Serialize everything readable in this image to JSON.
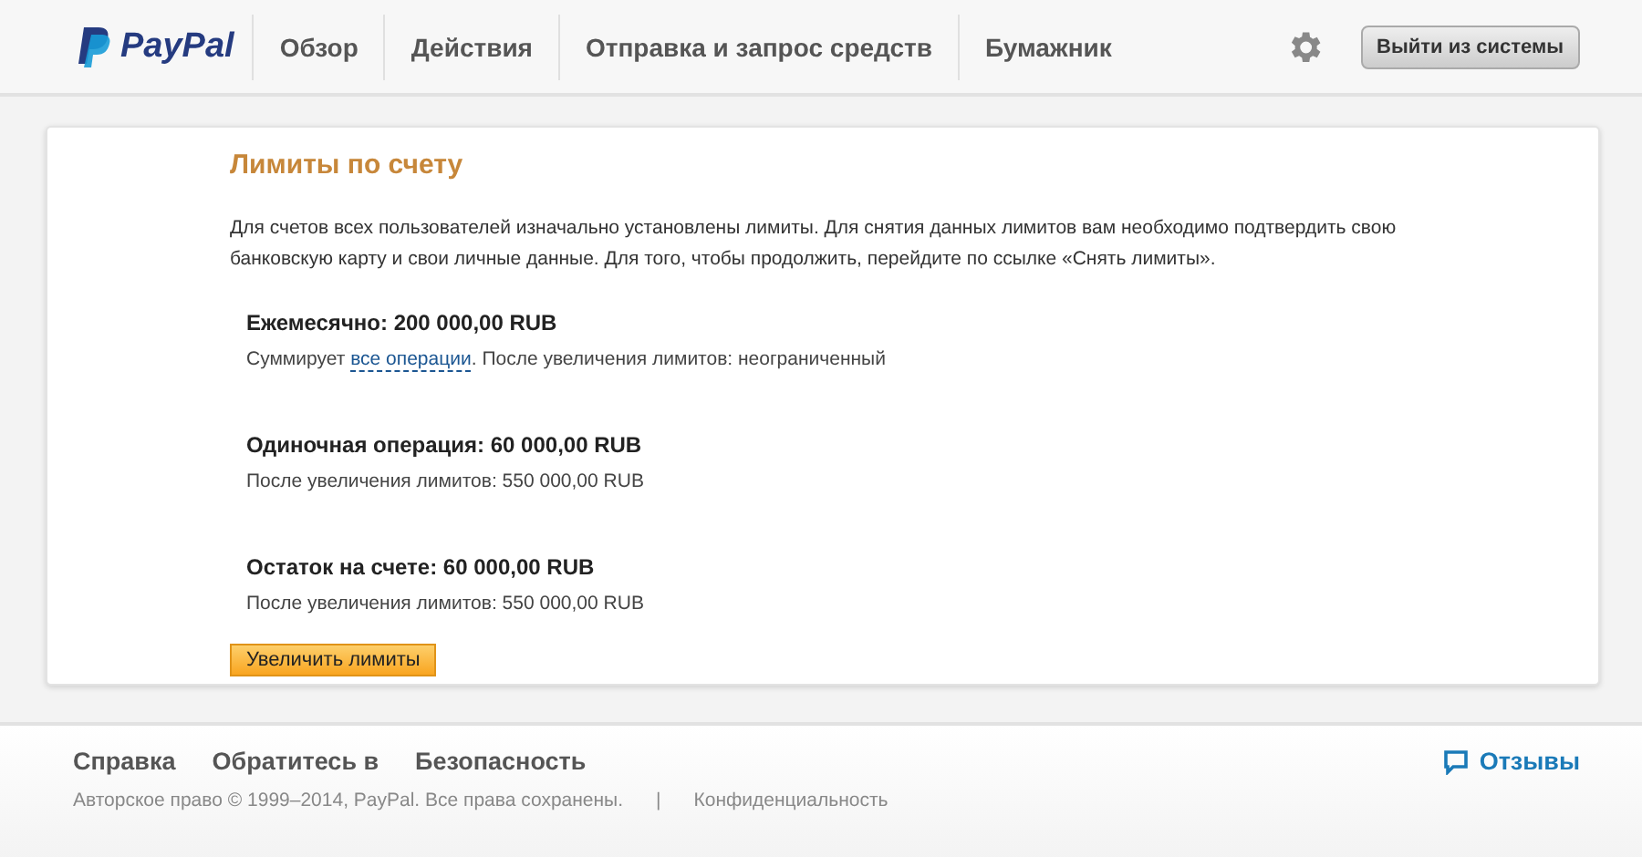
{
  "header": {
    "logo": "PayPal",
    "nav": [
      {
        "label": "Обзор"
      },
      {
        "label": "Действия"
      },
      {
        "label": "Отправка и запрос средств"
      },
      {
        "label": "Бумажник"
      }
    ],
    "logout": "Выйти из системы"
  },
  "card": {
    "title": "Лимиты по счету",
    "intro": "Для счетов всех пользователей изначально установлены лимиты. Для снятия данных лимитов вам необходимо подтвердить свою банковскую карту и свои личные данные. Для того, чтобы продолжить, перейдите по ссылке «Снять лимиты».",
    "limits": [
      {
        "heading": "Ежемесячно: 200 000,00 RUB",
        "note_before": "Суммирует ",
        "note_link": "все операции",
        "note_after": ". После увеличения лимитов: неограниченный"
      },
      {
        "heading": "Одиночная операция: 60 000,00 RUB",
        "note_before": "После увеличения лимитов: 550 000,00 RUB"
      },
      {
        "heading": "Остаток на счете: 60 000,00 RUB",
        "note_before": "После увеличения лимитов: 550 000,00 RUB"
      }
    ],
    "button": "Увеличить лимиты"
  },
  "footer": {
    "links": [
      "Справка",
      "Обратитесь в",
      "Безопасность"
    ],
    "copyright": "Авторское право © 1999–2014, PayPal. Все права сохранены.",
    "separator": "|",
    "privacy": "Конфиденциальность",
    "feedback": "Отзывы"
  }
}
